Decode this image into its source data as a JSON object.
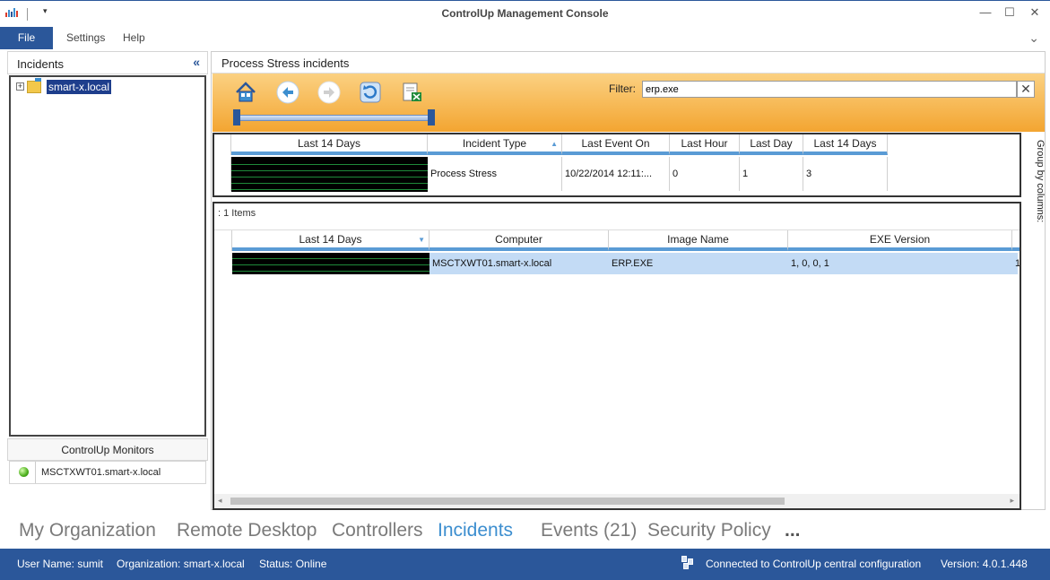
{
  "window": {
    "title": "ControlUp Management Console",
    "minimize": "—",
    "maximize": "☐",
    "close": "✕"
  },
  "menu": {
    "file": "File",
    "settings": "Settings",
    "help": "Help",
    "collapse": "⌄"
  },
  "left": {
    "header": "Incidents",
    "collapse": "«",
    "tree_node": "smart-x.local",
    "expander": "+",
    "monitors_header": "ControlUp Monitors",
    "monitor_name": "MSCTXWT01.smart-x.local"
  },
  "right": {
    "title": "Process Stress incidents",
    "filter_label": "Filter:",
    "filter_value": "erp.exe",
    "filter_clear": "✕",
    "group_by": "Group by columns:"
  },
  "summary_grid": {
    "headers": [
      "Last 14 Days",
      "Incident Type",
      "Last Event On",
      "Last Hour",
      "Last Day",
      "Last 14 Days"
    ],
    "row": {
      "incident_type": "Process Stress",
      "last_event_on": "10/22/2014 12:11:...",
      "last_hour": "0",
      "last_day": "1",
      "last_14_days": "3"
    }
  },
  "detail_grid": {
    "items_count": ": 1 Items",
    "headers": [
      "Last 14 Days",
      "Computer",
      "Image Name",
      "EXE Version"
    ],
    "row": {
      "computer": "MSCTXWT01.smart-x.local",
      "image_name": "ERP.EXE",
      "exe_version": "1, 0, 0, 1",
      "overflow": "1"
    }
  },
  "bottom_nav": {
    "tabs": [
      "My Organization",
      "Remote Desktop",
      "Controllers",
      "Incidents",
      "Events (21)",
      "Security Policy",
      "..."
    ],
    "active": "Incidents"
  },
  "statusbar": {
    "user": "User Name: sumit",
    "organization": "Organization: smart-x.local",
    "status": "Status: Online",
    "connection": "Connected to ControlUp central configuration",
    "version": "Version: 4.0.1.448"
  },
  "colors": {
    "accent": "#2b579a",
    "active_tab": "#3c8ecf",
    "toolbar_top": "#fbd182",
    "toolbar_bottom": "#f3a531",
    "selection": "#c3dbf5"
  }
}
